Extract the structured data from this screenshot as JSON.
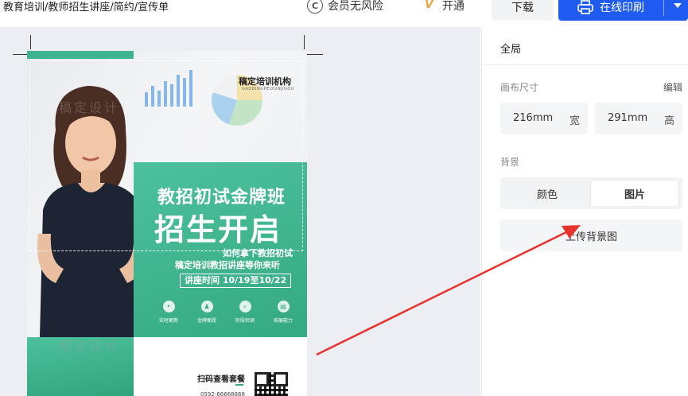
{
  "topbar": {
    "breadcrumb": "教育培训/教师招生讲座/简约/宣传单",
    "vip_label": "会员无风险",
    "vip_icon": "copyright-c-icon",
    "open_label": "开通",
    "download_label": "下载",
    "print_label": "在线印刷",
    "print_color": "#1f5bf0"
  },
  "poster": {
    "org_name": "稿定培训机构",
    "org_sub": "GAODINGPEIXUNJIGOU",
    "title1": "教招初试金牌班",
    "title2": "招生开启",
    "line1": "如何拿下教招初试",
    "line2": "稿定培训教招讲座等你来听",
    "time": "讲座时间 10/19至10/22",
    "features": [
      {
        "icon": "•",
        "label": "实时更新"
      },
      {
        "icon": "♟",
        "label": "金牌面授"
      },
      {
        "icon": "⌕",
        "label": "阶段检测"
      },
      {
        "icon": "▤",
        "label": "拓展能力"
      }
    ],
    "scan_label": "扫码查看套餐",
    "phone": "0592-66668888",
    "watermark": "稿定设计",
    "accent": "#3fb38f"
  },
  "panel": {
    "title": "全局",
    "canvas_size_label": "画布尺寸",
    "edit_label": "编辑",
    "width_value": "216mm",
    "width_unit": "宽",
    "height_value": "291mm",
    "height_unit": "高",
    "background_label": "背景",
    "bg_option_color": "颜色",
    "bg_option_image": "图片",
    "bg_selected": "图片",
    "upload_label": "上传背景图"
  },
  "annotation": {
    "arrow_color": "#e8322c"
  }
}
